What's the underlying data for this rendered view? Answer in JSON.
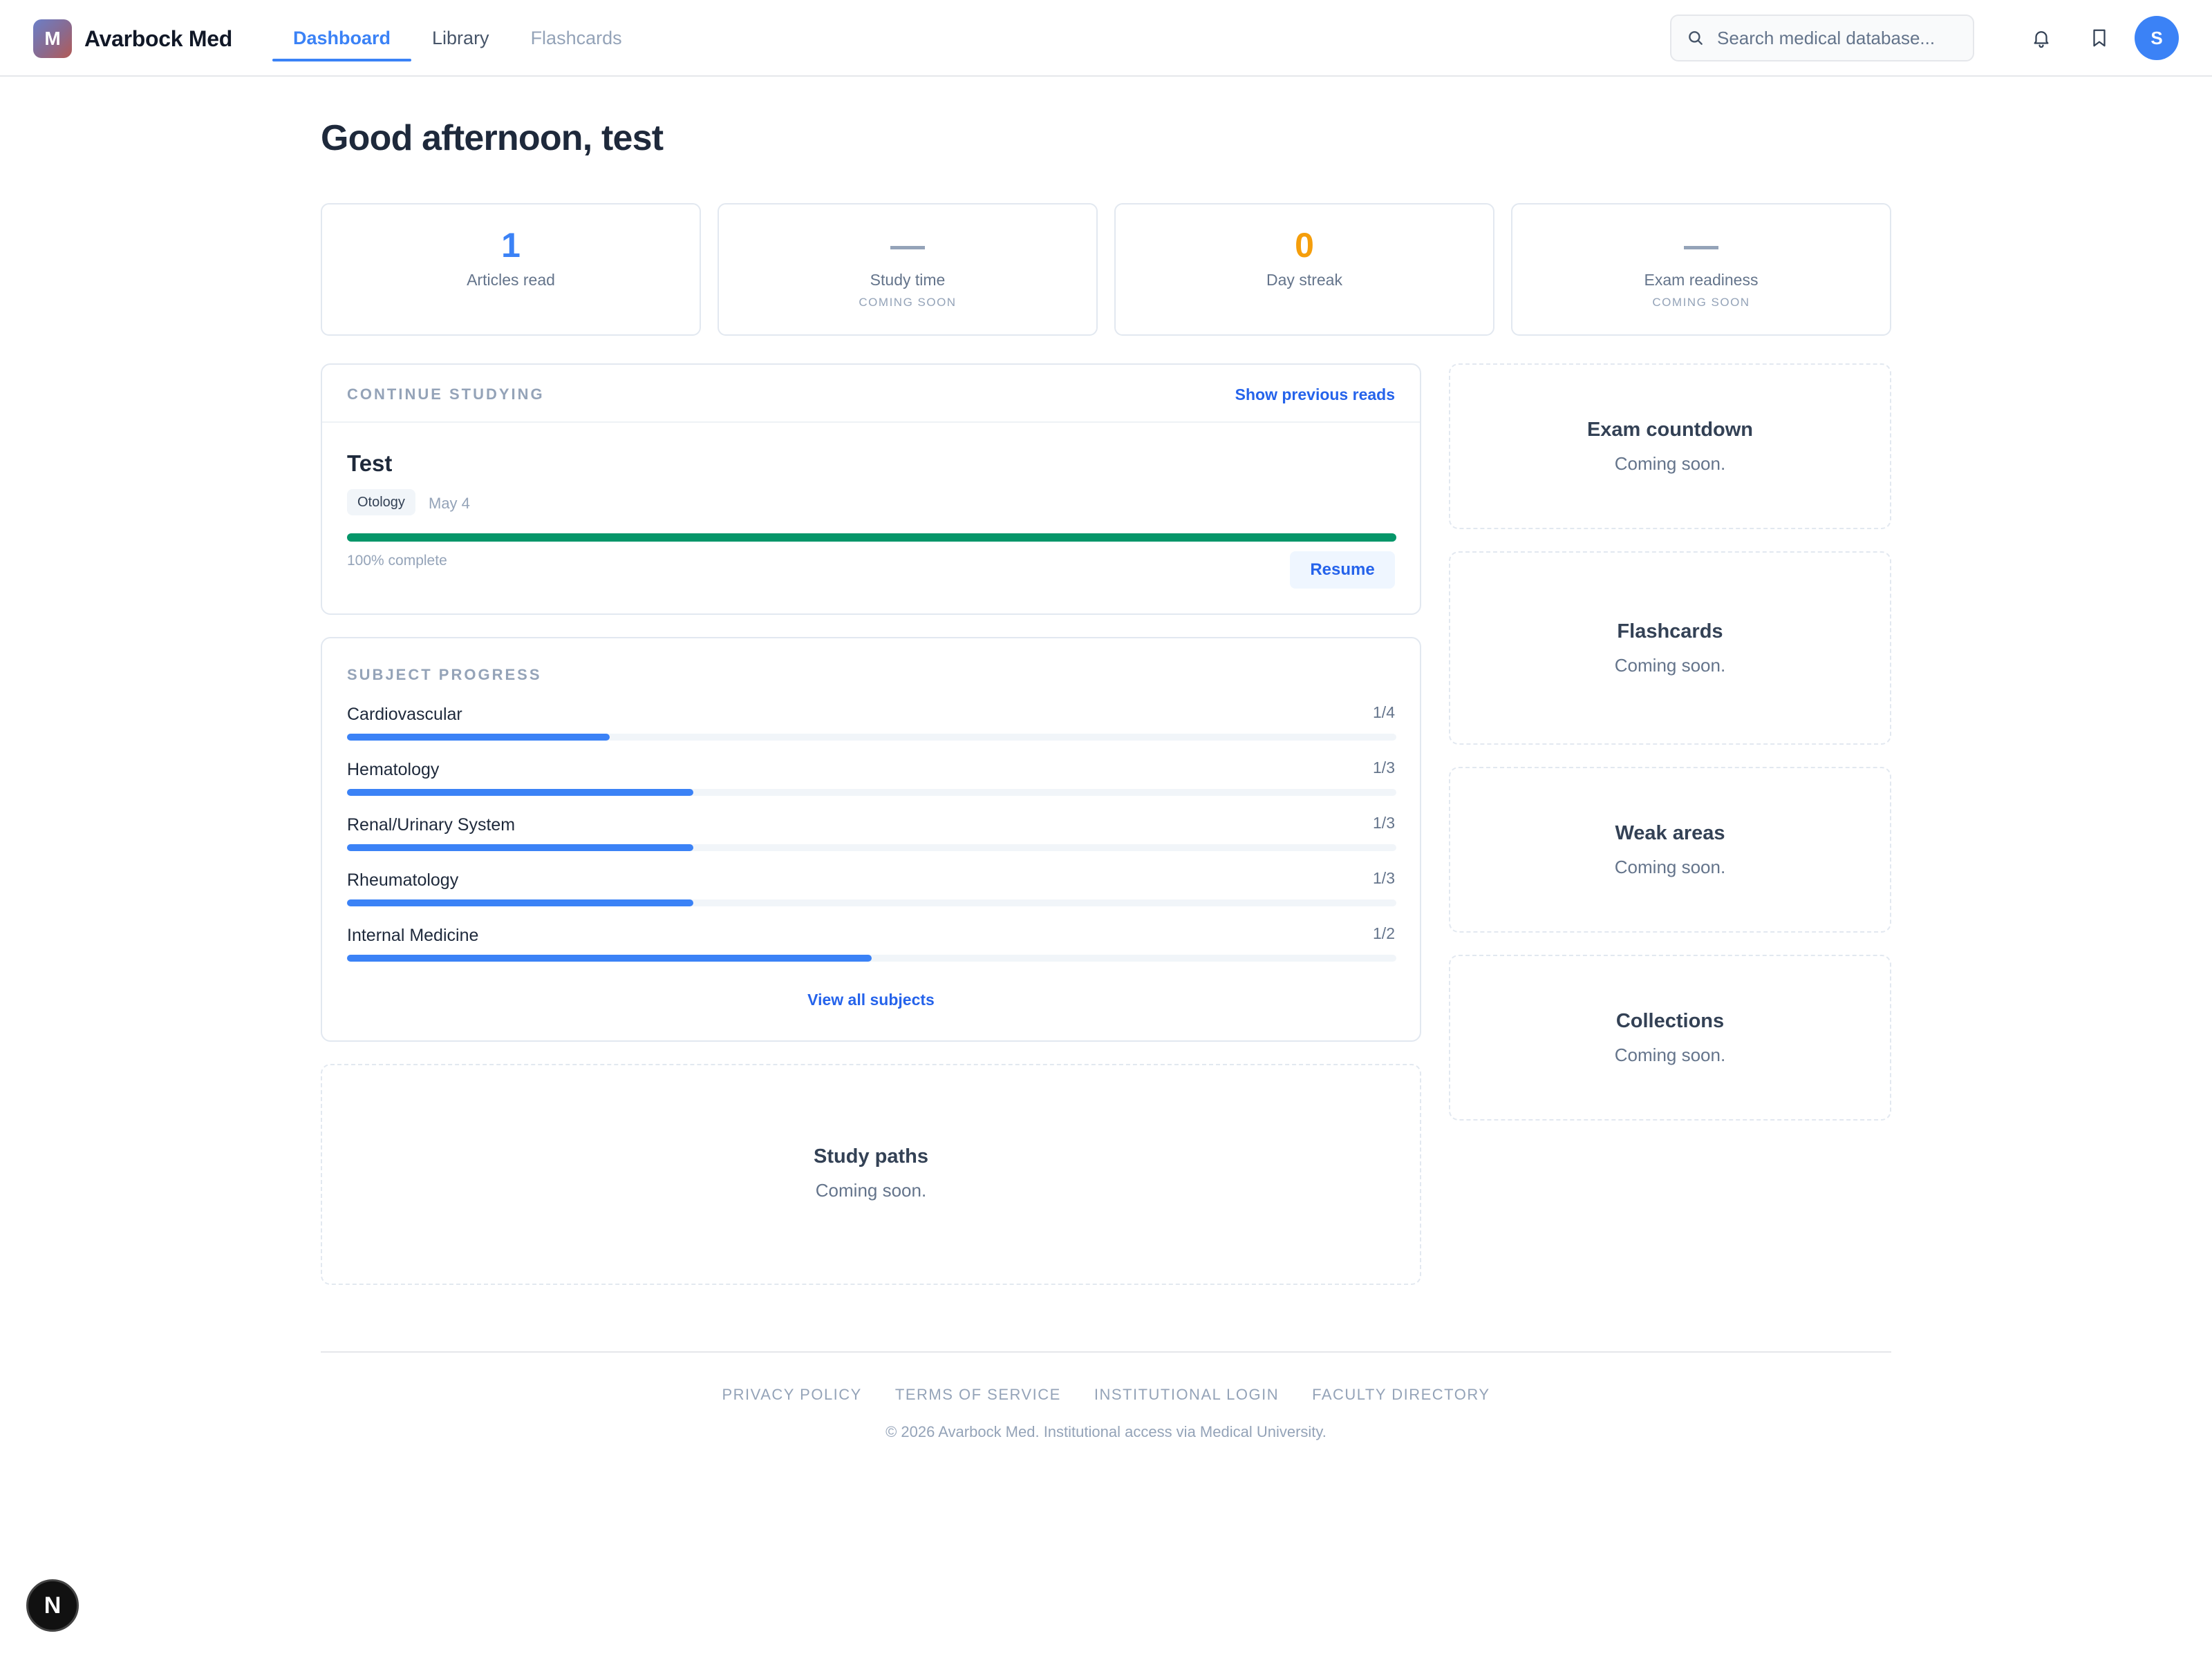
{
  "app": {
    "logo_letter": "M",
    "name": "Avarbock Med"
  },
  "nav": {
    "tabs": [
      {
        "label": "Dashboard",
        "active": true
      },
      {
        "label": "Library"
      },
      {
        "label": "Flashcards"
      }
    ]
  },
  "search": {
    "placeholder": "Search medical database..."
  },
  "header_icons": [
    "bell-icon",
    "bookmark-icon"
  ],
  "user": {
    "initial": "S"
  },
  "greeting": "Good afternoon, test",
  "stats": [
    {
      "value": "1",
      "label": "Articles read",
      "sub": "",
      "color": "#3b82f6"
    },
    {
      "value": "—",
      "label": "Study time",
      "sub": "COMING SOON",
      "color": "#94a3b8"
    },
    {
      "value": "0",
      "label": "Day streak",
      "sub": "",
      "color": "#f59e0b"
    },
    {
      "value": "—",
      "label": "Exam readiness",
      "sub": "COMING SOON",
      "color": "#94a3b8"
    }
  ],
  "continue": {
    "section_label": "CONTINUE STUDYING",
    "link": "Show previous reads",
    "article_title": "Test",
    "tag": "Otology",
    "date": "May 4",
    "progress": 1.0,
    "progress_color": "#059669",
    "progress_text": "100% complete",
    "resume_label": "Resume"
  },
  "subject_progress": {
    "section_label": "SUBJECT PROGRESS",
    "subjects": [
      {
        "name": "Cardiovascular",
        "count": "1/4",
        "fraction": 0.25
      },
      {
        "name": "Hematology",
        "count": "1/3",
        "fraction": 0.33
      },
      {
        "name": "Renal/Urinary System",
        "count": "1/3",
        "fraction": 0.33
      },
      {
        "name": "Rheumatology",
        "count": "1/3",
        "fraction": 0.33
      },
      {
        "name": "Internal Medicine",
        "count": "1/2",
        "fraction": 0.5
      }
    ],
    "view_all": "View all subjects"
  },
  "study_paths": {
    "title": "Study paths",
    "sub": "Coming soon."
  },
  "side_cards": [
    {
      "title": "Exam countdown",
      "sub": "Coming soon."
    },
    {
      "title": "Flashcards",
      "sub": "Coming soon."
    },
    {
      "title": "Weak areas",
      "sub": "Coming soon."
    },
    {
      "title": "Collections",
      "sub": "Coming soon."
    }
  ],
  "footer": {
    "links": [
      "PRIVACY POLICY",
      "TERMS OF SERVICE",
      "INSTITUTIONAL LOGIN",
      "FACULTY DIRECTORY"
    ],
    "copyright": "© 2026 Avarbock Med. Institutional access via Medical University."
  },
  "dev_badge": "N"
}
